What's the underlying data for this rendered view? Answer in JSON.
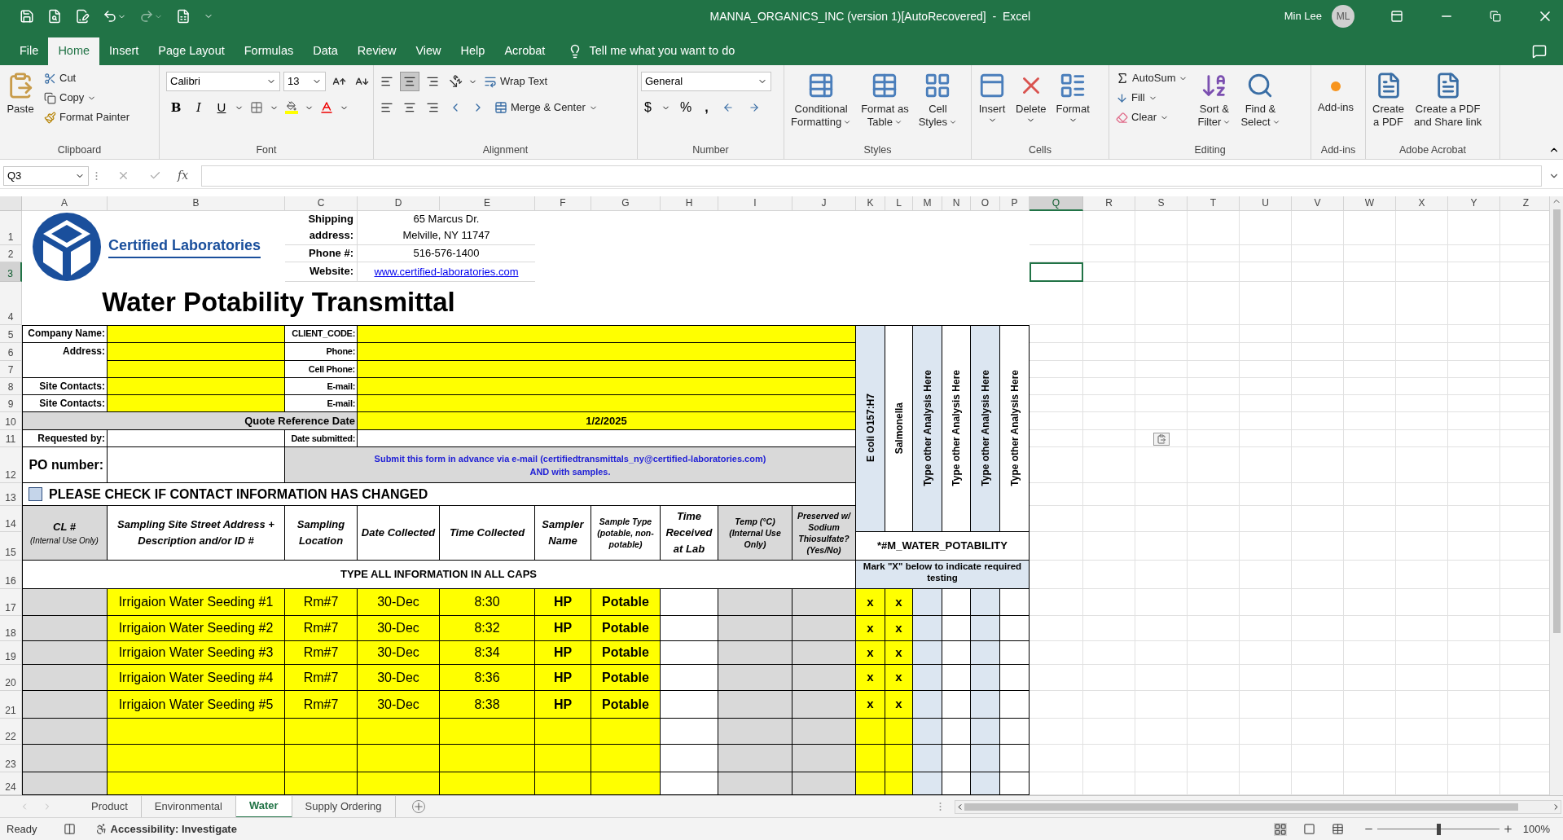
{
  "window": {
    "title": "MANNA_ORGANICS_INC (version 1)[AutoRecovered]  -  Excel",
    "user": "Min Lee",
    "avatar": "ML"
  },
  "menu_tabs": [
    {
      "label": "File",
      "selected": false
    },
    {
      "label": "Home",
      "selected": true
    },
    {
      "label": "Insert",
      "selected": false
    },
    {
      "label": "Page Layout",
      "selected": false
    },
    {
      "label": "Formulas",
      "selected": false
    },
    {
      "label": "Data",
      "selected": false
    },
    {
      "label": "Review",
      "selected": false
    },
    {
      "label": "View",
      "selected": false
    },
    {
      "label": "Help",
      "selected": false
    },
    {
      "label": "Acrobat",
      "selected": false
    }
  ],
  "tell_me": {
    "placeholder": "Tell me what you want to do"
  },
  "ribbon": {
    "clipboard": {
      "paste": "Paste",
      "cut": "Cut",
      "copy": "Copy",
      "format_painter": "Format Painter",
      "label": "Clipboard"
    },
    "font": {
      "name": "Calibri",
      "size": "13",
      "bold": "B",
      "italic": "I",
      "underline": "U",
      "label": "Font"
    },
    "alignment": {
      "vertical": [
        {
          "selected": false
        },
        {
          "selected": true
        },
        {
          "selected": false
        }
      ],
      "wrap_text": "Wrap Text",
      "merge_center": "Merge & Center",
      "label": "Alignment"
    },
    "number": {
      "format": "General",
      "currency": "$",
      "percent": "%",
      "comma": ",",
      "label": "Number"
    },
    "styles": {
      "buttons": [
        {
          "lines": [
            "Conditional",
            "Formatting"
          ]
        },
        {
          "lines": [
            "Format as",
            "Table"
          ]
        },
        {
          "lines": [
            "Cell",
            "Styles"
          ]
        }
      ],
      "label": "Styles"
    },
    "cells": {
      "buttons": [
        {
          "lines": [
            "Insert"
          ]
        },
        {
          "lines": [
            "Delete"
          ]
        },
        {
          "lines": [
            "Format"
          ]
        }
      ],
      "label": "Cells"
    },
    "editing": {
      "autosum": "AutoSum",
      "fill": "Fill",
      "clear": "Clear",
      "sort": [
        "Sort &",
        "Filter"
      ],
      "find": [
        "Find &",
        "Select"
      ],
      "label": "Editing"
    },
    "addins": {
      "button": "Add-ins",
      "label": "Add-ins"
    },
    "acrobat": {
      "buttons": [
        {
          "lines": [
            "Create",
            "a PDF"
          ]
        },
        {
          "lines": [
            "Create a PDF",
            "and Share link"
          ]
        }
      ],
      "label": "Adobe Acrobat"
    }
  },
  "formula_bar": {
    "name_box": "Q3",
    "function_label": "fx"
  },
  "columns": [
    {
      "label": "A",
      "selected": false
    },
    {
      "label": "B",
      "selected": false
    },
    {
      "label": "C",
      "selected": false
    },
    {
      "label": "D",
      "selected": false
    },
    {
      "label": "E",
      "selected": false
    },
    {
      "label": "F",
      "selected": false
    },
    {
      "label": "G",
      "selected": false
    },
    {
      "label": "H",
      "selected": false
    },
    {
      "label": "I",
      "selected": false
    },
    {
      "label": "J",
      "selected": false
    },
    {
      "label": "K",
      "selected": false
    },
    {
      "label": "L",
      "selected": false
    },
    {
      "label": "M",
      "selected": false
    },
    {
      "label": "N",
      "selected": false
    },
    {
      "label": "O",
      "selected": false
    },
    {
      "label": "P",
      "selected": false
    },
    {
      "label": "Q",
      "selected": true
    },
    {
      "label": "R",
      "selected": false
    },
    {
      "label": "S",
      "selected": false
    },
    {
      "label": "T",
      "selected": false
    },
    {
      "label": "U",
      "selected": false
    },
    {
      "label": "V",
      "selected": false
    },
    {
      "label": "W",
      "selected": false
    },
    {
      "label": "X",
      "selected": false
    },
    {
      "label": "Y",
      "selected": false
    },
    {
      "label": "Z",
      "selected": false
    }
  ],
  "rows": [
    {
      "label": "1",
      "selected": false
    },
    {
      "label": "2",
      "selected": false
    },
    {
      "label": "3",
      "selected": true
    },
    {
      "label": "4",
      "selected": false
    },
    {
      "label": "5",
      "selected": false
    },
    {
      "label": "6",
      "selected": false
    },
    {
      "label": "7",
      "selected": false
    },
    {
      "label": "8",
      "selected": false
    },
    {
      "label": "9",
      "selected": false
    },
    {
      "label": "10",
      "selected": false
    },
    {
      "label": "11",
      "selected": false
    },
    {
      "label": "12",
      "selected": false
    },
    {
      "label": "13",
      "selected": false
    },
    {
      "label": "14",
      "selected": false
    },
    {
      "label": "15",
      "selected": false
    },
    {
      "label": "16",
      "selected": false
    },
    {
      "label": "17",
      "selected": false
    },
    {
      "label": "18",
      "selected": false
    },
    {
      "label": "19",
      "selected": false
    },
    {
      "label": "20",
      "selected": false
    },
    {
      "label": "21",
      "selected": false
    },
    {
      "label": "22",
      "selected": false
    },
    {
      "label": "23",
      "selected": false
    },
    {
      "label": "24",
      "selected": false
    }
  ],
  "sheet": {
    "company": "Certified Laboratories",
    "shipping_label": "Shipping address:",
    "address": [
      "65 Marcus Dr.",
      "Melville, NY 11747"
    ],
    "phone_label": "Phone #:",
    "phone": "516-576-1400",
    "website_label": "Website:",
    "website": "www.certified-laboratories.com",
    "title": "Water Potability Transmittal",
    "contact_left": [
      "Company Name:",
      "Address:",
      "Site Contacts:",
      "Site Contacts:"
    ],
    "contact_right": [
      "CLIENT_CODE:",
      "Phone:",
      "Cell Phone:",
      "E-mail:",
      "E-mail:"
    ],
    "quote_label": "Quote Reference Date",
    "quote_date": "1/2/2025",
    "requested_label": "Requested by:",
    "submitted_label": "Date submitted:",
    "po_label": "PO number:",
    "note": "Submit this form in advance via e-mail (certifiedtransmittals_ny@certified-laboratories.com) AND with samples.",
    "contact_changed": {
      "label": "PLEASE CHECK IF CONTACT INFORMATION HAS CHANGED",
      "checked": false
    },
    "analyses": [
      {
        "label": "E coli O157:H7",
        "shaded": true
      },
      {
        "label": "Salmonella",
        "shaded": false
      },
      {
        "label": "Type other Analysis Here",
        "shaded": true
      },
      {
        "label": "Type other Analysis Here",
        "shaded": false
      },
      {
        "label": "Type other Analysis Here",
        "shaded": true
      },
      {
        "label": "Type other Analysis Here",
        "shaded": false
      }
    ],
    "headers": [
      {
        "title": "CL #",
        "note": "(Internal Use Only)",
        "shaded": true
      },
      {
        "title": "Sampling Site Street Address + Description and/or ID #",
        "shaded": false
      },
      {
        "title": "Sampling Location",
        "shaded": false
      },
      {
        "title": "Date Collected",
        "shaded": false
      },
      {
        "title": "Time  Collected",
        "shaded": false
      },
      {
        "title": "Sampler Name",
        "shaded": false
      },
      {
        "title": "Sample Type (potable, non-potable)",
        "shaded": false
      },
      {
        "title": "Time Received at Lab",
        "shaded": false
      },
      {
        "title": "Temp (°C) (Internal Use Only)",
        "shaded": true
      },
      {
        "title": "Preserved w/ Sodium Thiosulfate? (Yes/No)",
        "shaded": true
      }
    ],
    "test_code": "*#M_WATER_POTABILITY",
    "caps_note": "TYPE ALL INFORMATION IN ALL CAPS",
    "mark_note": "Mark \"X\" below to indicate required testing",
    "samples": [
      {
        "site": "Irrigaion Water Seeding #1",
        "location": "Rm#7",
        "date": "30-Dec",
        "time": "8:30",
        "sampler": "HP",
        "type": "Potable",
        "marks": [
          "x",
          "x"
        ]
      },
      {
        "site": "Irrigaion Water Seeding #2",
        "location": "Rm#7",
        "date": "30-Dec",
        "time": "8:32",
        "sampler": "HP",
        "type": "Potable",
        "marks": [
          "x",
          "x"
        ]
      },
      {
        "site": "Irrigaion Water Seeding #3",
        "location": "Rm#7",
        "date": "30-Dec",
        "time": "8:34",
        "sampler": "HP",
        "type": "Potable",
        "marks": [
          "x",
          "x"
        ]
      },
      {
        "site": "Irrigaion Water Seeding #4",
        "location": "Rm#7",
        "date": "30-Dec",
        "time": "8:36",
        "sampler": "HP",
        "type": "Potable",
        "marks": [
          "x",
          "x"
        ]
      },
      {
        "site": "Irrigaion Water Seeding #5",
        "location": "Rm#7",
        "date": "30-Dec",
        "time": "8:38",
        "sampler": "HP",
        "type": "Potable",
        "marks": [
          "x",
          "x"
        ]
      }
    ]
  },
  "sheet_tabs": [
    {
      "label": "Product",
      "selected": false
    },
    {
      "label": "Environmental",
      "selected": false
    },
    {
      "label": "Water",
      "selected": true
    },
    {
      "label": "Supply Ordering",
      "selected": false
    }
  ],
  "status_bar": {
    "ready": "Ready",
    "accessibility": "Accessibility: Investigate",
    "zoom": {
      "label": "100%",
      "level": 0.5
    }
  }
}
